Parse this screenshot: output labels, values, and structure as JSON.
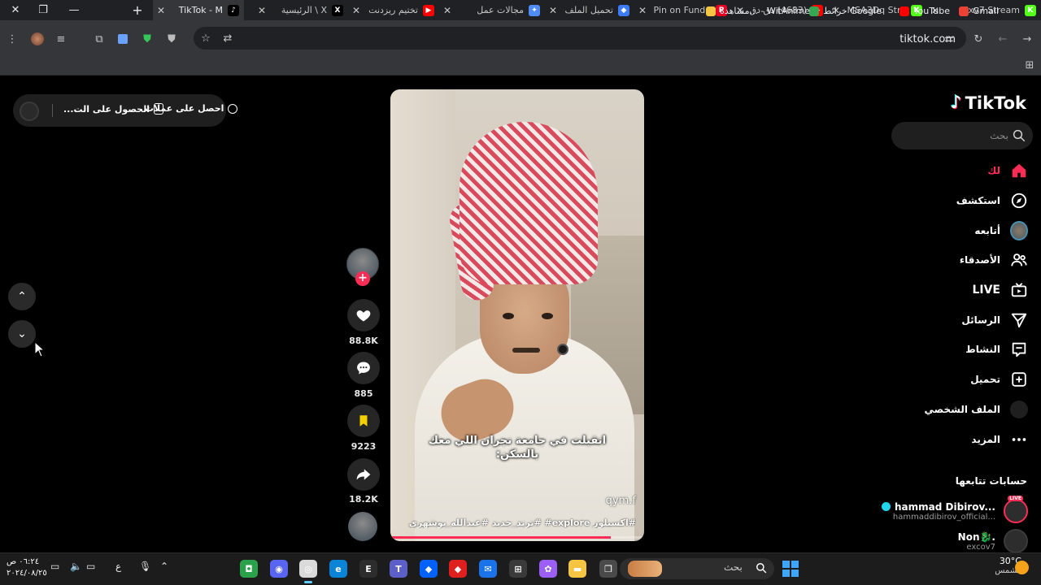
{
  "browser": {
    "tabs": [
      {
        "title": "Nxv7 Stream",
        "fav_color": "#53fc18",
        "fav_glyph": "K"
      },
      {
        "title": "MSA3Dq Stre",
        "fav_color": "#53fc18",
        "fav_glyph": "K"
      },
      {
        "title": "(4683) دق دق",
        "fav_color": "#ff0000",
        "fav_glyph": "▶"
      },
      {
        "title": "Pin on Fundo",
        "fav_color": "#e60023",
        "fav_glyph": "P"
      },
      {
        "title": "تحميل الملف",
        "fav_color": "#3d7bf5",
        "fav_glyph": "◆"
      },
      {
        "title": "مجالات عمل",
        "fav_color": "#4f8df5",
        "fav_glyph": "✦"
      },
      {
        "title": "تختيم ريزدنت",
        "fav_color": "#ff0000",
        "fav_glyph": "▶"
      },
      {
        "title": "X \\ الرئيسية",
        "fav_color": "#000000",
        "fav_glyph": "X"
      },
      {
        "title": "TikTok - M",
        "fav_color": "#000000",
        "fav_glyph": "♪",
        "active": true
      }
    ],
    "url": "tiktok.com",
    "bookmarks": [
      {
        "label": "Gmail",
        "color": "#ea4335"
      },
      {
        "label": "YouTube",
        "color": "#ff0000"
      },
      {
        "label": "خرائط Google",
        "color": "#34a853"
      },
      {
        "label": "مشاهدة... - WitAnime",
        "color": "#f4c542"
      }
    ]
  },
  "promo": {
    "item1": "احصل على عملات",
    "item2": "الحصول على الت..."
  },
  "video": {
    "caption_line1": "انقبلت في جامعة نجران اللي معك",
    "caption_line2": "بالسكن:",
    "watermark": "qym.f",
    "hashtags": "#اكسبلور explore# #ترند_جديد #عبدالله_بوشهري",
    "progress": 0.87
  },
  "actions": {
    "likes": "88.8K",
    "comments": "885",
    "saves": "9223",
    "shares": "18.2K"
  },
  "sidebar": {
    "brand": "TikTok",
    "search_placeholder": "بحث",
    "items": [
      {
        "label": "لك",
        "icon": "home-icon",
        "active": true
      },
      {
        "label": "استكشف",
        "icon": "compass-icon"
      },
      {
        "label": "أتابعه",
        "icon": "following-avatar"
      },
      {
        "label": "الأصدقاء",
        "icon": "friends-icon"
      },
      {
        "label": "LIVE",
        "icon": "live-icon"
      },
      {
        "label": "الرسائل",
        "icon": "send-icon"
      },
      {
        "label": "النشاط",
        "icon": "inbox-icon"
      },
      {
        "label": "تحميل",
        "icon": "upload-icon"
      },
      {
        "label": "الملف الشخصي",
        "icon": "profile-avatar"
      },
      {
        "label": "المزيد",
        "icon": "more-icon"
      }
    ],
    "following_title": "حسابات تتابعها",
    "accounts": [
      {
        "name": "hammad Dibirov...",
        "user": "hammaddibirov_official...",
        "verified": true,
        "live": "LIVE"
      },
      {
        "name": "Non🐉.",
        "user": "excov7",
        "verified": false
      }
    ]
  },
  "taskbar": {
    "search_label": "بحث",
    "weather_temp": "30°C",
    "weather_desc": "مشمس",
    "time": "٠٦:٢٤ ص",
    "date": "٢٠٢٤/٠٨/٢٥",
    "lang": "ع"
  }
}
